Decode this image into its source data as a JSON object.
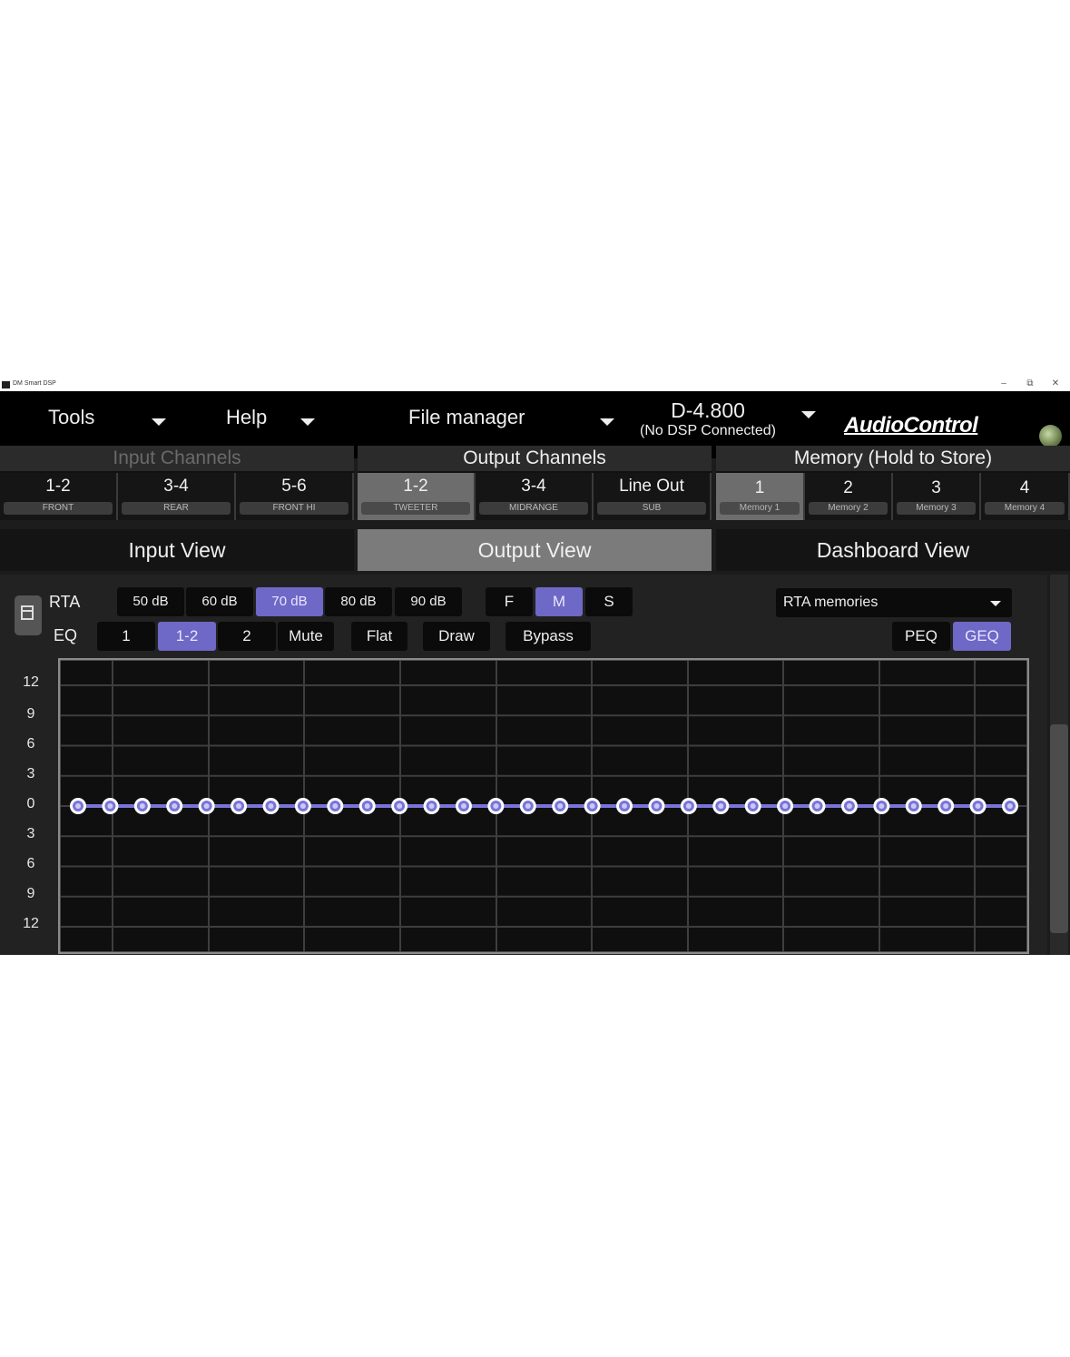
{
  "window": {
    "title": "DM Smart DSP",
    "controls": [
      "–",
      "⧉",
      "✕"
    ]
  },
  "menu": {
    "tools": "Tools",
    "help": "Help",
    "file_manager": "File manager",
    "device_name": "D-4.800",
    "device_status": "(No DSP Connected)",
    "brand": "AudioControl"
  },
  "input_channels": {
    "title": "Input Channels",
    "channels": [
      {
        "label": "1-2",
        "sub": "FRONT"
      },
      {
        "label": "3-4",
        "sub": "REAR"
      },
      {
        "label": "5-6",
        "sub": "FRONT HI"
      }
    ]
  },
  "output_channels": {
    "title": "Output Channels",
    "selected": "1-2",
    "channels": [
      {
        "label": "1-2",
        "sub": "TWEETER"
      },
      {
        "label": "3-4",
        "sub": "MIDRANGE"
      },
      {
        "label": "Line Out",
        "sub": "SUB"
      }
    ]
  },
  "memory": {
    "title": "Memory (Hold to Store)",
    "selected": "1",
    "slots": [
      {
        "label": "1",
        "sub": "Memory 1"
      },
      {
        "label": "2",
        "sub": "Memory 2"
      },
      {
        "label": "3",
        "sub": "Memory 3"
      },
      {
        "label": "4",
        "sub": "Memory 4"
      }
    ]
  },
  "views": {
    "input": "Input View",
    "output": "Output View",
    "dashboard": "Dashboard View",
    "active": "Output View"
  },
  "rta": {
    "label": "RTA",
    "levels": [
      "50 dB",
      "60 dB",
      "70 dB",
      "80 dB",
      "90 dB"
    ],
    "selected_level": "70 dB",
    "modes": [
      "F",
      "M",
      "S"
    ],
    "selected_mode": "M",
    "memories_dropdown": "RTA memories"
  },
  "eq": {
    "label": "EQ",
    "channels": [
      "1",
      "1-2",
      "2"
    ],
    "selected_channel": "1-2",
    "mute": "Mute",
    "flat": "Flat",
    "draw": "Draw",
    "bypass": "Bypass",
    "peq": "PEQ",
    "geq": "GEQ",
    "selected_type": "GEQ"
  },
  "geq_graph": {
    "y_ticks": [
      "12",
      "9",
      "6",
      "3",
      "0",
      "3",
      "6",
      "9",
      "12"
    ],
    "y_range_db": [
      -12,
      12
    ],
    "band_count": 30,
    "band_gains_db": [
      0,
      0,
      0,
      0,
      0,
      0,
      0,
      0,
      0,
      0,
      0,
      0,
      0,
      0,
      0,
      0,
      0,
      0,
      0,
      0,
      0,
      0,
      0,
      0,
      0,
      0,
      0,
      0,
      0,
      0
    ],
    "colors": {
      "line": "#7a73d8",
      "handle_fill": "#c9c9f2",
      "handle_ring": "#ffffff",
      "grid": "#3e3e3e",
      "background": "#0f0f0f"
    }
  },
  "colors": {
    "accent": "#6e68c6",
    "panel": "#222222"
  }
}
